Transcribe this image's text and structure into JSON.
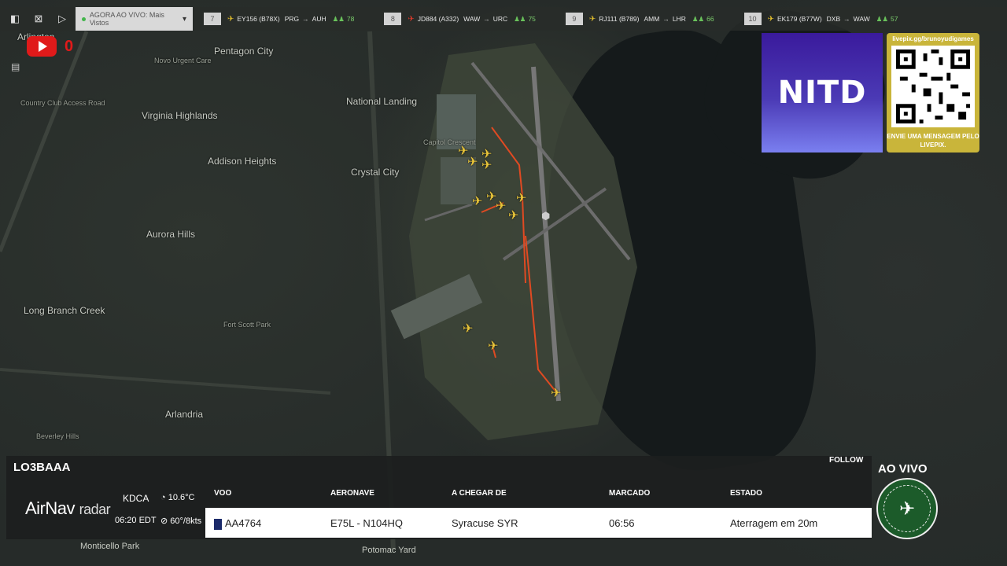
{
  "topbar": {
    "now_live": "AGORA AO VIVO: Mais Vistos",
    "flights": [
      {
        "num": "7",
        "code": "EY156 (B78X)",
        "from": "PRG",
        "to": "AUH",
        "pax": "78",
        "color": "yellow"
      },
      {
        "num": "8",
        "code": "JD884 (A332)",
        "from": "WAW",
        "to": "URC",
        "pax": "75",
        "color": "red"
      },
      {
        "num": "9",
        "code": "RJ111 (B789)",
        "from": "AMM",
        "to": "LHR",
        "pax": "66",
        "color": "yellow"
      },
      {
        "num": "10",
        "code": "EK179 (B77W)",
        "from": "DXB",
        "to": "WAW",
        "pax": "57",
        "color": "yellow"
      }
    ]
  },
  "overlay": {
    "yt_count": "0"
  },
  "sponsor": {
    "logo": "NITD",
    "url": "livepix.gg/brunoyudigames",
    "message": "ENVIE UMA MENSAGEM PELO LIVEPIX."
  },
  "map_labels": [
    "Arlington",
    "Pentagon City",
    "Novo Urgent Care",
    "Virginia Highlands",
    "Addison Heights",
    "Aurora Hills",
    "Crystal City",
    "National Landing",
    "Long Branch Creek",
    "Fort Scott Park",
    "Arlandria",
    "Beverley Hills",
    "Monticello Park",
    "Potomac Yard",
    "Capitol Crescent",
    "Country Club Access Road"
  ],
  "panel": {
    "callsign": "LO3BAAA",
    "follow": "FOLLOW",
    "brand_main": "AirNav",
    "brand_sub": "radar",
    "airport": "KDCA",
    "time": "06:20 EDT",
    "temp": "10.6°C",
    "wind": "60°/8kts",
    "headers": {
      "flight": "VOO",
      "aircraft": "AERONAVE",
      "from": "A CHEGAR DE",
      "scheduled": "MARCADO",
      "status": "ESTADO"
    },
    "row": {
      "flight": "AA4764",
      "aircraft": "E75L - N104HQ",
      "from": "Syracuse SYR",
      "scheduled": "06:56",
      "status": "Aterragem em 20m"
    }
  },
  "live": {
    "label": "AO VIVO"
  }
}
